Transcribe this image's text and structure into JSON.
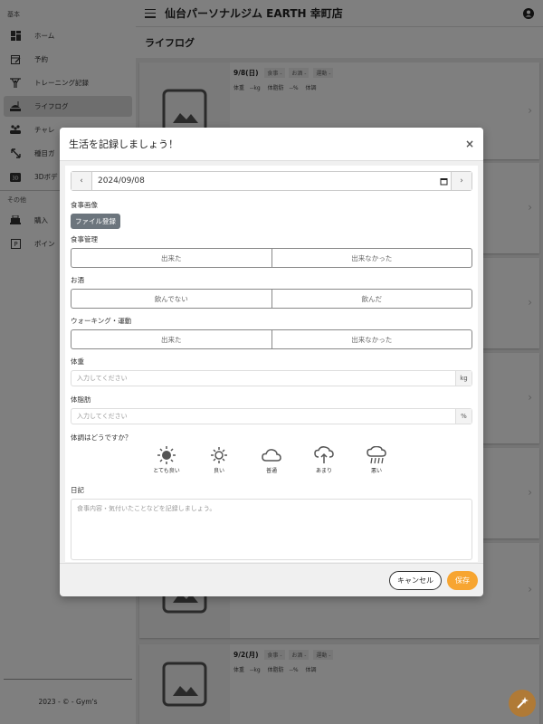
{
  "sidebar": {
    "section_basic": "基本",
    "section_other": "その他",
    "items": [
      {
        "label": "ホーム",
        "icon": "dashboard-icon"
      },
      {
        "label": "予約",
        "icon": "calendar-edit-icon"
      },
      {
        "label": "トレーニング記録",
        "icon": "weightlifter-icon"
      },
      {
        "label": "ライフログ",
        "icon": "food-log-icon"
      },
      {
        "label": "チャレ",
        "icon": "people-icon"
      },
      {
        "label": "種目ガ",
        "icon": "arrows-diagonal-icon"
      },
      {
        "label": "3Dボデ",
        "icon": "3d-body-icon"
      }
    ],
    "other_items": [
      {
        "label": "購入",
        "icon": "cart-icon"
      },
      {
        "label": "ポイン",
        "icon": "points-icon"
      }
    ],
    "footer": "2023 - © - Gym's"
  },
  "header": {
    "title": "仙台パーソナルジム EARTH 幸町店"
  },
  "page": {
    "title": "ライフログ"
  },
  "cards": [
    {
      "date": "9/8(日)",
      "tags": [
        "食事 -",
        "お酒 -",
        "運動 -"
      ],
      "weight_label": "体重",
      "weight": "--kg",
      "fat_label": "体脂肪",
      "fat": "--%",
      "cond_label": "体調"
    },
    {
      "date": "9/2(月)",
      "tags": [
        "食事 -",
        "お酒 -",
        "運動 -"
      ],
      "weight_label": "体重",
      "weight": "--kg",
      "fat_label": "体脂肪",
      "fat": "--%",
      "cond_label": "体調"
    }
  ],
  "modal": {
    "title": "生活を記録しましょう！",
    "close": "×",
    "date_prev": "‹",
    "date_next": "›",
    "date_value": "2024/09/08",
    "meal_image_label": "食事画像",
    "file_button": "ファイル登録",
    "meal_label": "食事管理",
    "meal_options": [
      "出来た",
      "出来なかった"
    ],
    "alcohol_label": "お酒",
    "alcohol_options": [
      "飲んでない",
      "飲んだ"
    ],
    "walk_label": "ウォーキング・運動",
    "walk_options": [
      "出来た",
      "出来なかった"
    ],
    "weight_label": "体重",
    "weight_placeholder": "入力してください",
    "weight_unit": "kg",
    "fat_label": "体脂肪",
    "fat_placeholder": "入力してください",
    "fat_unit": "%",
    "condition_label": "体調はどうですか？",
    "conditions": [
      {
        "label": "とても良い",
        "icon": "sun-filled-icon"
      },
      {
        "label": "良い",
        "icon": "sun-outline-icon"
      },
      {
        "label": "普通",
        "icon": "cloud-icon"
      },
      {
        "label": "あまり",
        "icon": "cloud-drizzle-icon"
      },
      {
        "label": "悪い",
        "icon": "cloud-rain-icon"
      }
    ],
    "diary_label": "日記",
    "diary_placeholder": "食事内容・気付いたことなどを記録しましょう。",
    "cancel": "キャンセル",
    "save": "保存"
  },
  "colors": {
    "accent": "#f7a531",
    "file_button": "#6c757d",
    "fab": "#b07a36"
  }
}
